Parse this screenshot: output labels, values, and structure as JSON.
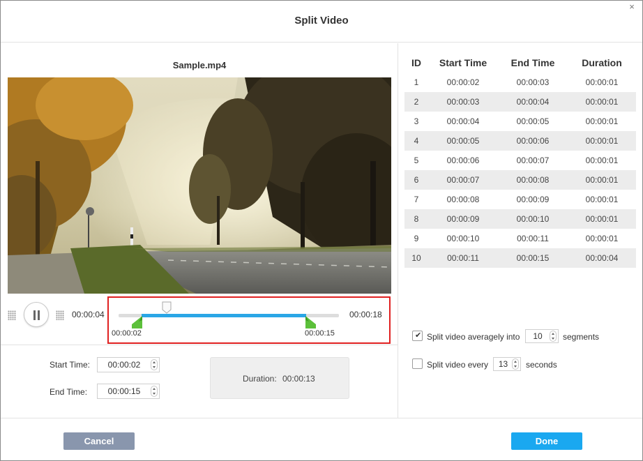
{
  "dialog": {
    "title": "Split Video",
    "close_glyph": "×"
  },
  "player": {
    "file_name": "Sample.mp4",
    "current_time": "00:00:04",
    "end_time": "00:00:18",
    "selection_start_label": "00:00:02",
    "selection_end_label": "00:00:15",
    "play_state": "pause-icon"
  },
  "range": {
    "start_label": "Start Time:",
    "start_value": "00:00:02",
    "end_label": "End Time:",
    "end_value": "00:00:15",
    "duration_label": "Duration:",
    "duration_value": "00:00:13"
  },
  "segments": {
    "columns": [
      "ID",
      "Start Time",
      "End Time",
      "Duration"
    ],
    "rows": [
      [
        "1",
        "00:00:02",
        "00:00:03",
        "00:00:01"
      ],
      [
        "2",
        "00:00:03",
        "00:00:04",
        "00:00:01"
      ],
      [
        "3",
        "00:00:04",
        "00:00:05",
        "00:00:01"
      ],
      [
        "4",
        "00:00:05",
        "00:00:06",
        "00:00:01"
      ],
      [
        "5",
        "00:00:06",
        "00:00:07",
        "00:00:01"
      ],
      [
        "6",
        "00:00:07",
        "00:00:08",
        "00:00:01"
      ],
      [
        "7",
        "00:00:08",
        "00:00:09",
        "00:00:01"
      ],
      [
        "8",
        "00:00:09",
        "00:00:10",
        "00:00:01"
      ],
      [
        "9",
        "00:00:10",
        "00:00:11",
        "00:00:01"
      ],
      [
        "10",
        "00:00:11",
        "00:00:15",
        "00:00:04"
      ]
    ]
  },
  "options": {
    "average": {
      "checked": true,
      "label_before": "Split video averagely into",
      "value": "10",
      "label_after": "segments"
    },
    "every": {
      "checked": false,
      "label_before": "Split video every",
      "value": "13",
      "label_after": "seconds"
    }
  },
  "footer": {
    "cancel_label": "Cancel",
    "done_label": "Done"
  },
  "colors": {
    "accent": "#1aa8f0",
    "cancel": "#8996ad",
    "selection": "#2aa6e6",
    "marker": "#5cc03a",
    "highlight_border": "#e02020"
  }
}
